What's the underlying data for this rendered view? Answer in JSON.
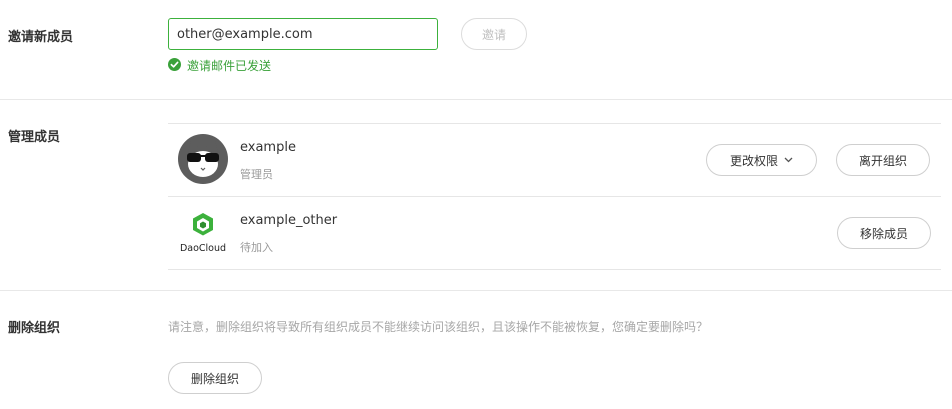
{
  "invite": {
    "section_label": "邀请新成员",
    "email_value": "other@example.com",
    "button_label": "邀请",
    "success_message": "邀请邮件已发送"
  },
  "members": {
    "section_label": "管理成员",
    "list": [
      {
        "name": "example",
        "role": "管理员",
        "avatar": "cat-avatar-icon",
        "actions": [
          "更改权限",
          "离开组织"
        ]
      },
      {
        "name": "example_other",
        "role": "待加入",
        "avatar": "daocloud-logo-icon",
        "avatar_logo_text": "DaoCloud",
        "actions": [
          "移除成员"
        ]
      }
    ]
  },
  "delete_org": {
    "section_label": "删除组织",
    "warning": "请注意，删除组织将导致所有组织成员不能继续访问该组织，且该操作不能被恢复，您确定要删除吗？",
    "button_label": "删除组织"
  },
  "colors": {
    "accent_green": "#3cb13c",
    "success_green": "#3aa13a"
  }
}
